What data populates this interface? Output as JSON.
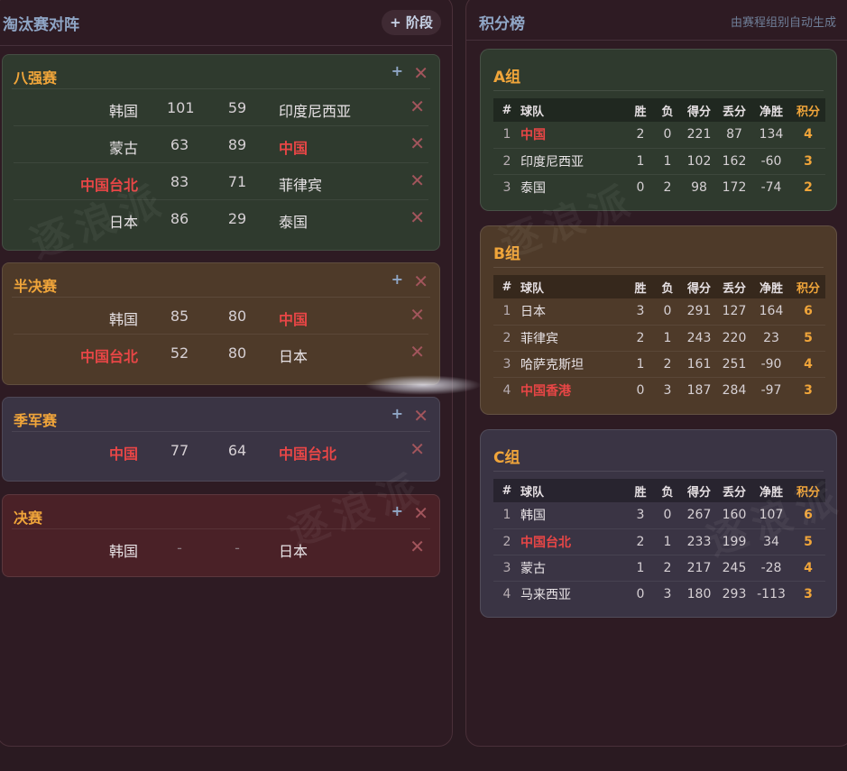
{
  "knockout": {
    "title": "淘汰赛对阵",
    "add_stage_label": "+ 阶段",
    "stages": [
      {
        "name": "八强赛",
        "matches": [
          {
            "team_a": "韩国",
            "score_a": "101",
            "score_b": "59",
            "team_b": "印度尼西亚",
            "highlight_a": false,
            "highlight_b": false
          },
          {
            "team_a": "蒙古",
            "score_a": "63",
            "score_b": "89",
            "team_b": "中国",
            "highlight_a": false,
            "highlight_b": true
          },
          {
            "team_a": "中国台北",
            "score_a": "83",
            "score_b": "71",
            "team_b": "菲律宾",
            "highlight_a": true,
            "highlight_b": false
          },
          {
            "team_a": "日本",
            "score_a": "86",
            "score_b": "29",
            "team_b": "泰国",
            "highlight_a": false,
            "highlight_b": false
          }
        ]
      },
      {
        "name": "半决赛",
        "matches": [
          {
            "team_a": "韩国",
            "score_a": "85",
            "score_b": "80",
            "team_b": "中国",
            "highlight_a": false,
            "highlight_b": true
          },
          {
            "team_a": "中国台北",
            "score_a": "52",
            "score_b": "80",
            "team_b": "日本",
            "highlight_a": true,
            "highlight_b": false
          }
        ]
      },
      {
        "name": "季军赛",
        "matches": [
          {
            "team_a": "中国",
            "score_a": "77",
            "score_b": "64",
            "team_b": "中国台北",
            "highlight_a": true,
            "highlight_b": true
          }
        ]
      },
      {
        "name": "决赛",
        "matches": [
          {
            "team_a": "韩国",
            "score_a": "-",
            "score_b": "-",
            "team_b": "日本",
            "highlight_a": false,
            "highlight_b": false
          }
        ]
      }
    ]
  },
  "standings": {
    "title": "积分榜",
    "note": "由赛程组别自动生成",
    "headers": {
      "rank": "#",
      "team": "球队",
      "w": "胜",
      "l": "负",
      "pf": "得分",
      "pa": "丢分",
      "diff": "净胜",
      "pts": "积分"
    },
    "groups": [
      {
        "name": "A组",
        "rows": [
          {
            "rank": "1",
            "team": "中国",
            "w": "2",
            "l": "0",
            "pf": "221",
            "pa": "87",
            "diff": "134",
            "pts": "4",
            "highlight": true
          },
          {
            "rank": "2",
            "team": "印度尼西亚",
            "w": "1",
            "l": "1",
            "pf": "102",
            "pa": "162",
            "diff": "-60",
            "pts": "3",
            "highlight": false
          },
          {
            "rank": "3",
            "team": "泰国",
            "w": "0",
            "l": "2",
            "pf": "98",
            "pa": "172",
            "diff": "-74",
            "pts": "2",
            "highlight": false
          }
        ]
      },
      {
        "name": "B组",
        "rows": [
          {
            "rank": "1",
            "team": "日本",
            "w": "3",
            "l": "0",
            "pf": "291",
            "pa": "127",
            "diff": "164",
            "pts": "6",
            "highlight": false
          },
          {
            "rank": "2",
            "team": "菲律宾",
            "w": "2",
            "l": "1",
            "pf": "243",
            "pa": "220",
            "diff": "23",
            "pts": "5",
            "highlight": false
          },
          {
            "rank": "3",
            "team": "哈萨克斯坦",
            "w": "1",
            "l": "2",
            "pf": "161",
            "pa": "251",
            "diff": "-90",
            "pts": "4",
            "highlight": false
          },
          {
            "rank": "4",
            "team": "中国香港",
            "w": "0",
            "l": "3",
            "pf": "187",
            "pa": "284",
            "diff": "-97",
            "pts": "3",
            "highlight": true
          }
        ]
      },
      {
        "name": "C组",
        "rows": [
          {
            "rank": "1",
            "team": "韩国",
            "w": "3",
            "l": "0",
            "pf": "267",
            "pa": "160",
            "diff": "107",
            "pts": "6",
            "highlight": false
          },
          {
            "rank": "2",
            "team": "中国台北",
            "w": "2",
            "l": "1",
            "pf": "233",
            "pa": "199",
            "diff": "34",
            "pts": "5",
            "highlight": true
          },
          {
            "rank": "3",
            "team": "蒙古",
            "w": "1",
            "l": "2",
            "pf": "217",
            "pa": "245",
            "diff": "-28",
            "pts": "4",
            "highlight": false
          },
          {
            "rank": "4",
            "team": "马来西亚",
            "w": "0",
            "l": "3",
            "pf": "180",
            "pa": "293",
            "diff": "-113",
            "pts": "3",
            "highlight": false
          }
        ]
      }
    ]
  },
  "watermark": "逐浪派",
  "icons": {
    "add": "plus-icon",
    "remove": "close-icon"
  },
  "colors": {
    "accent": "#f0a53a",
    "highlight": "#e84646",
    "title": "#8fa6c6"
  }
}
